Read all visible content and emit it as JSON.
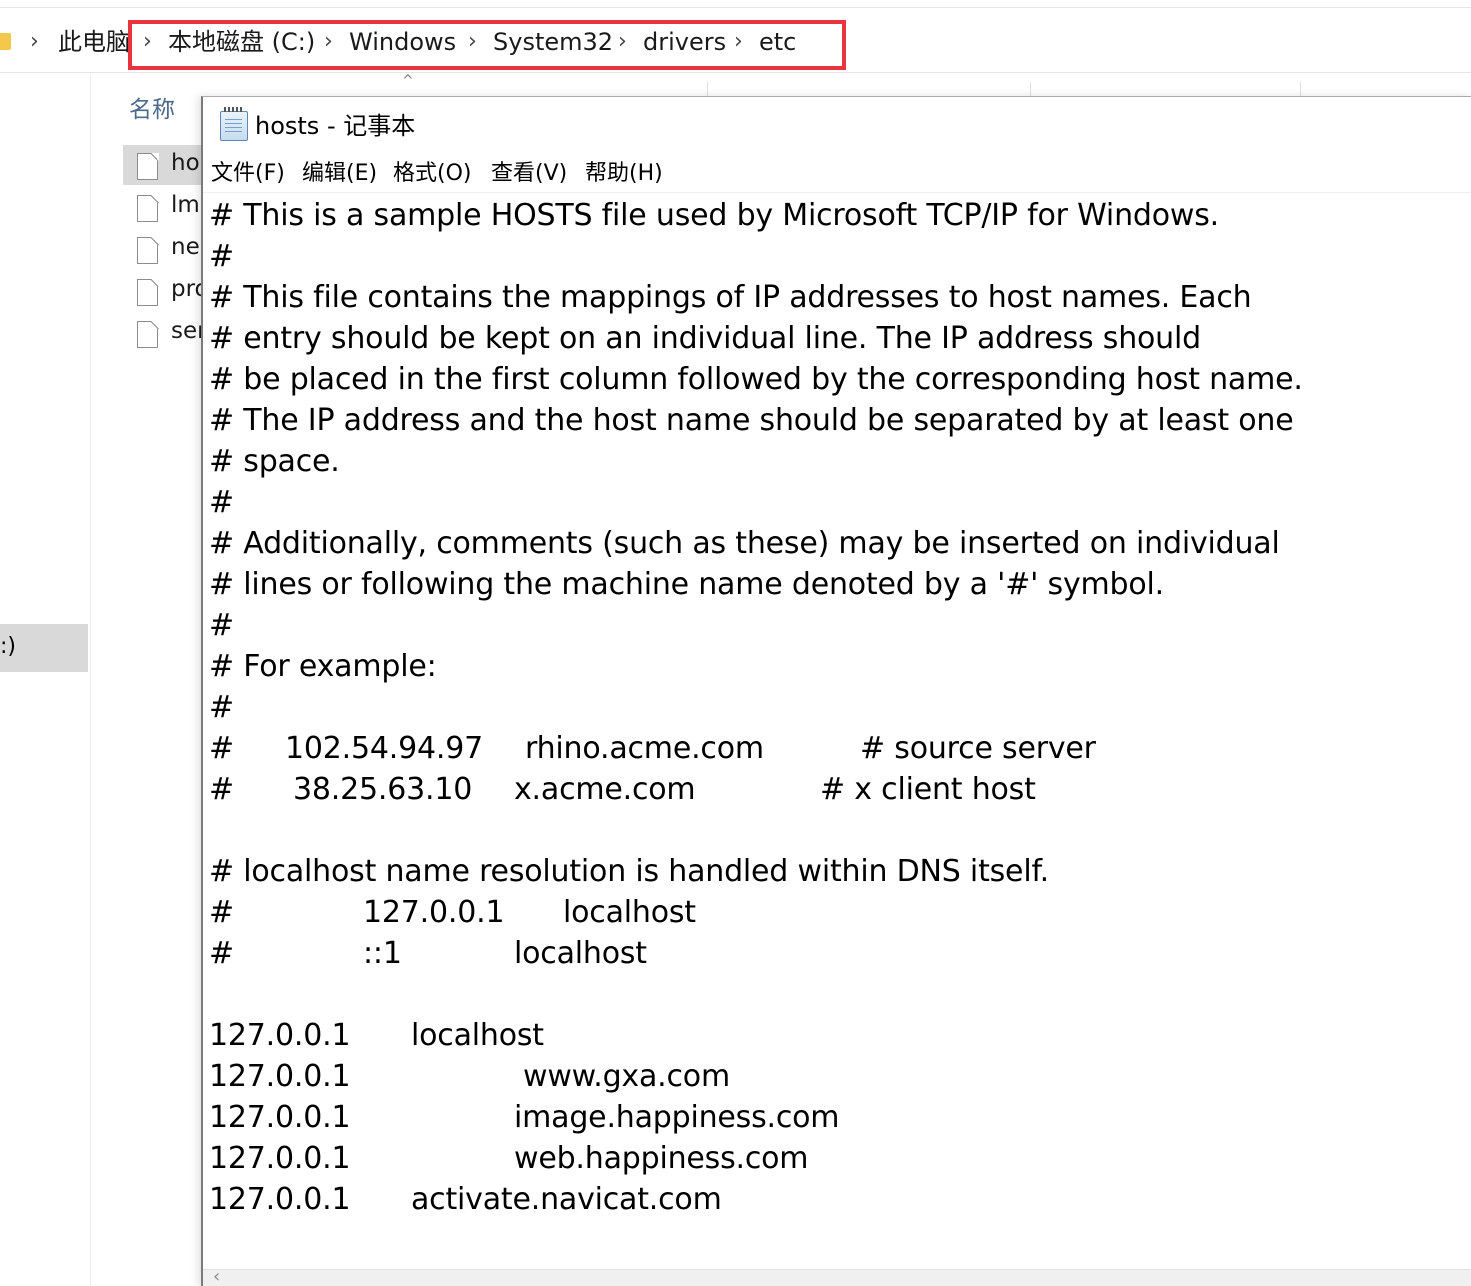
{
  "explorer": {
    "breadcrumbs": [
      "此电脑",
      "本地磁盘 (C:)",
      "Windows",
      "System32",
      "drivers",
      "etc"
    ],
    "column_name_header": "名称",
    "files": [
      {
        "label": "ho",
        "selected": true
      },
      {
        "label": "lml",
        "selected": false
      },
      {
        "label": "ne",
        "selected": false
      },
      {
        "label": "pro",
        "selected": false
      },
      {
        "label": "ser",
        "selected": false
      }
    ],
    "nav_selected_label": ":)",
    "icons": {
      "folder": "folder-icon",
      "chevron": "chevron-right-icon",
      "file": "file-icon",
      "sort": "sort-caret-icon"
    },
    "highlight_color": "#e8343f"
  },
  "notepad": {
    "title": "hosts - 记事本",
    "menu": [
      "文件(F)",
      "编辑(E)",
      "格式(O)",
      "查看(V)",
      "帮助(H)"
    ],
    "icon": "notepad-icon",
    "content_lines": [
      [
        "# This is a sample HOSTS file used by Microsoft TCP/IP for Windows."
      ],
      [
        "#"
      ],
      [
        "# This file contains the mappings of IP addresses to host names. Each"
      ],
      [
        "# entry should be kept on an individual line. The IP address should"
      ],
      [
        "# be placed in the first column followed by the corresponding host name."
      ],
      [
        "# The IP address and the host name should be separated by at least one"
      ],
      [
        "# space."
      ],
      [
        "#"
      ],
      [
        "# Additionally, comments (such as these) may be inserted on individual"
      ],
      [
        "# lines or following the machine name denoted by a '#' symbol."
      ],
      [
        "#"
      ],
      [
        "# For example:"
      ],
      [
        "#"
      ],
      [
        "#",
        "102.54.94.97",
        "rhino.acme.com",
        "# source server"
      ],
      [
        "#",
        "38.25.63.10",
        "x.acme.com",
        "# x client host"
      ],
      [
        ""
      ],
      [
        "# localhost name resolution is handled within DNS itself."
      ],
      [
        "#",
        "127.0.0.1",
        "localhost"
      ],
      [
        "#",
        "::1",
        "localhost"
      ],
      [
        ""
      ],
      [
        "127.0.0.1",
        "localhost"
      ],
      [
        "127.0.0.1",
        "www.gxa.com"
      ],
      [
        "127.0.0.1",
        "image.happiness.com"
      ],
      [
        "127.0.0.1",
        "web.happiness.com"
      ],
      [
        "127.0.0.1",
        "activate.navicat.com"
      ]
    ]
  }
}
